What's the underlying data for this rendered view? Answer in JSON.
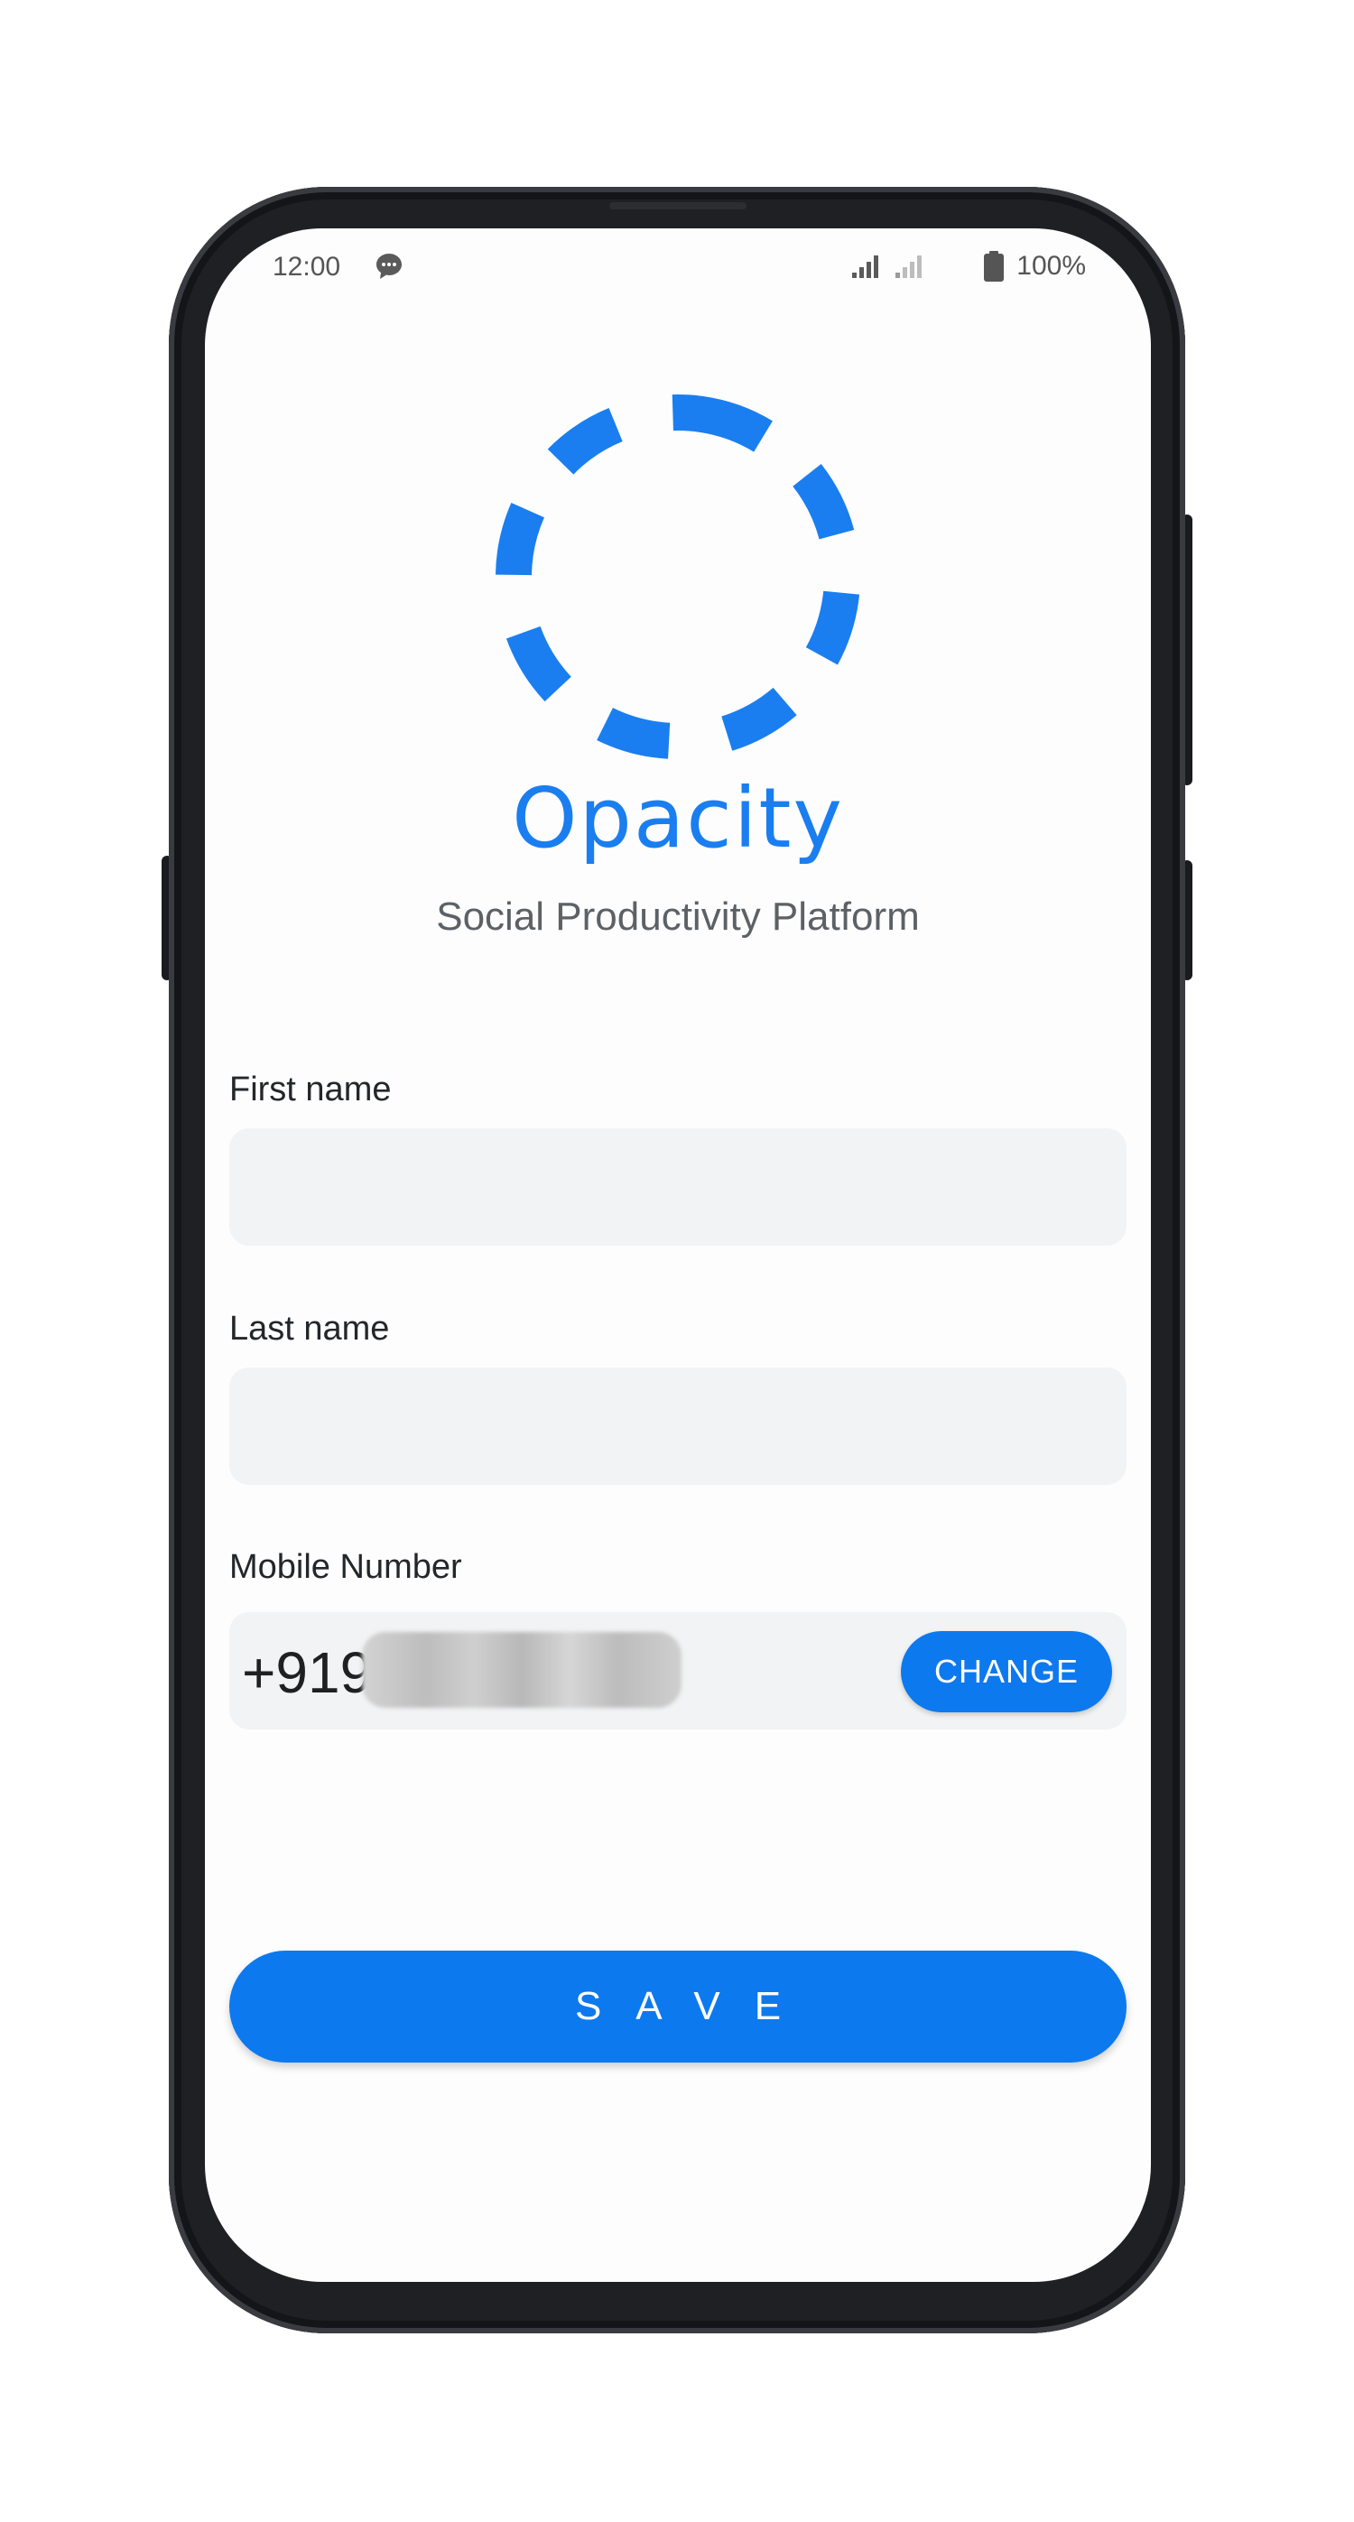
{
  "status_bar": {
    "time": "12:00",
    "battery": "100%",
    "icons": [
      "message-icon",
      "signal-strong-icon",
      "signal-weak-icon",
      "battery-icon"
    ]
  },
  "brand": {
    "name": "Opacity",
    "tagline": "Social Productivity Platform",
    "accent_color": "#1a7ef0"
  },
  "form": {
    "first_name_label": "First name",
    "first_name_value": "",
    "last_name_label": "Last name",
    "last_name_value": "",
    "mobile_label": "Mobile Number",
    "mobile_prefix": "+919",
    "change_label": "CHANGE"
  },
  "actions": {
    "save_label": "SAVE"
  }
}
